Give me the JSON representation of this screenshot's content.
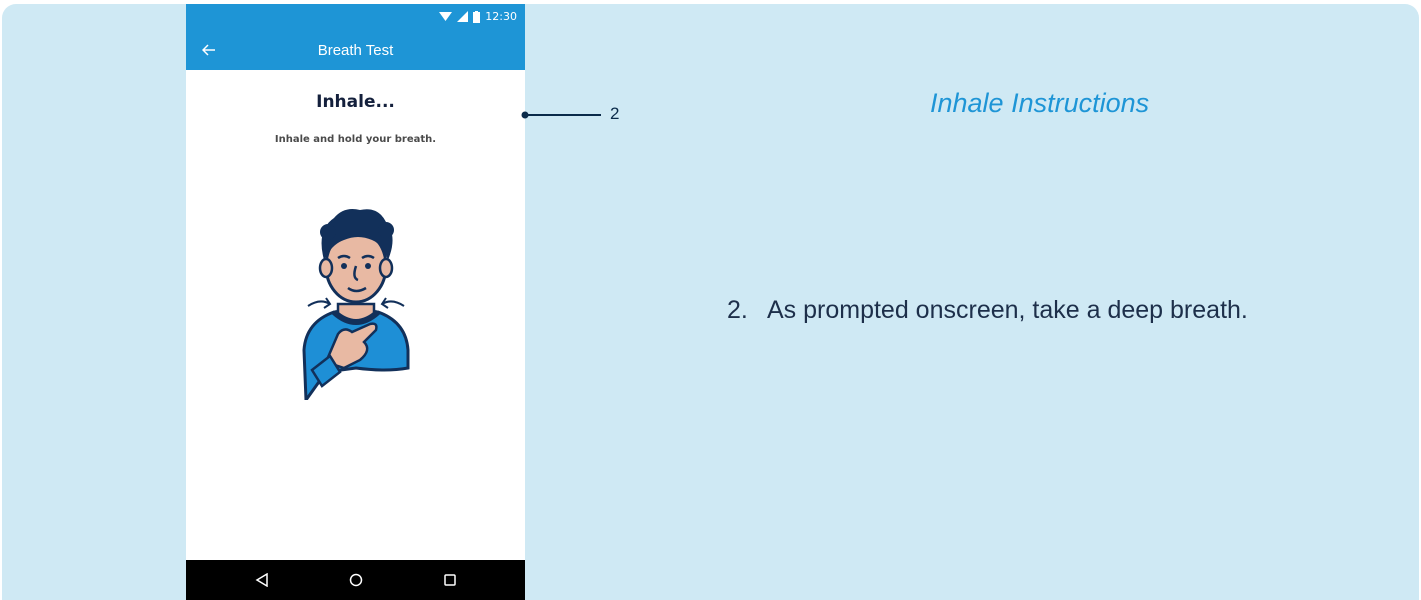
{
  "status_bar": {
    "time": "12:30",
    "icons": [
      "wifi-icon",
      "signal-icon",
      "battery-icon"
    ]
  },
  "app_bar": {
    "title": "Breath Test",
    "back_icon": "arrow-left-icon"
  },
  "screen": {
    "heading": "Inhale...",
    "instruction": "Inhale and hold your breath.",
    "illustration": "person-inhaling-illustration"
  },
  "nav_bar": {
    "buttons": [
      "back-triangle-icon",
      "home-circle-icon",
      "recents-square-icon"
    ]
  },
  "callout": {
    "number": "2"
  },
  "side_panel": {
    "title": "Inhale Instructions",
    "step_number": "2.",
    "step_text": "As prompted onscreen, take a deep breath."
  },
  "colors": {
    "panel_background": "#cfe9f4",
    "app_bar": "#1e95d6",
    "title_blue": "#1e95d6",
    "text_dark": "#1d2f4a",
    "nav_bar": "#000000"
  }
}
